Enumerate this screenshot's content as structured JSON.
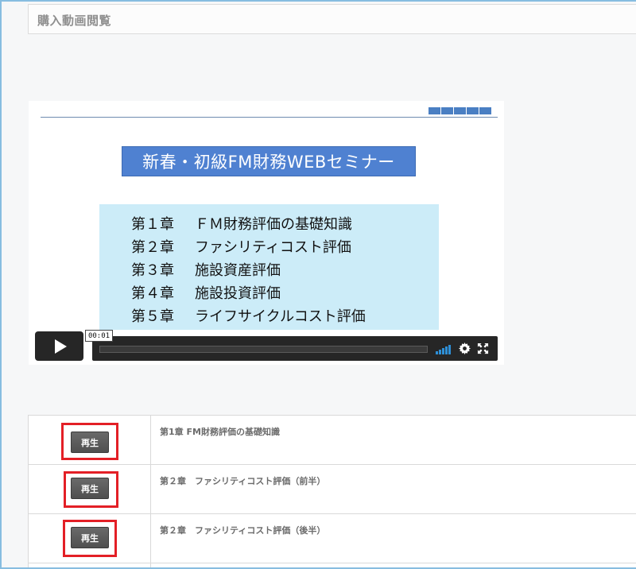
{
  "page": {
    "title": "購入動画閲覧"
  },
  "slide": {
    "title": "新春・初級FM財務WEBセミナー",
    "chapters": [
      {
        "num": "第１章",
        "title": "ＦＭ財務評価の基礎知識"
      },
      {
        "num": "第２章",
        "title": "ファシリティコスト評価"
      },
      {
        "num": "第３章",
        "title": "施設資産評価"
      },
      {
        "num": "第４章",
        "title": "施設投資評価"
      },
      {
        "num": "第５章",
        "title": "ライフサイクルコスト評価"
      }
    ]
  },
  "player": {
    "time": "00:01",
    "progress": 0.0,
    "icons": [
      "play-icon",
      "volume-icon",
      "gear-icon",
      "fullscreen-icon"
    ]
  },
  "videos": [
    {
      "button": "再生",
      "title": "第1章 FM財務評価の基礎知識"
    },
    {
      "button": "再生",
      "title": "第２章　ファシリティコスト評価（前半）"
    },
    {
      "button": "再生",
      "title": "第２章　ファシリティコスト評価（後半）"
    }
  ],
  "colors": {
    "highlight": "#e31f26",
    "accent": "#4f81d1",
    "volume": "#2e8fd6"
  }
}
